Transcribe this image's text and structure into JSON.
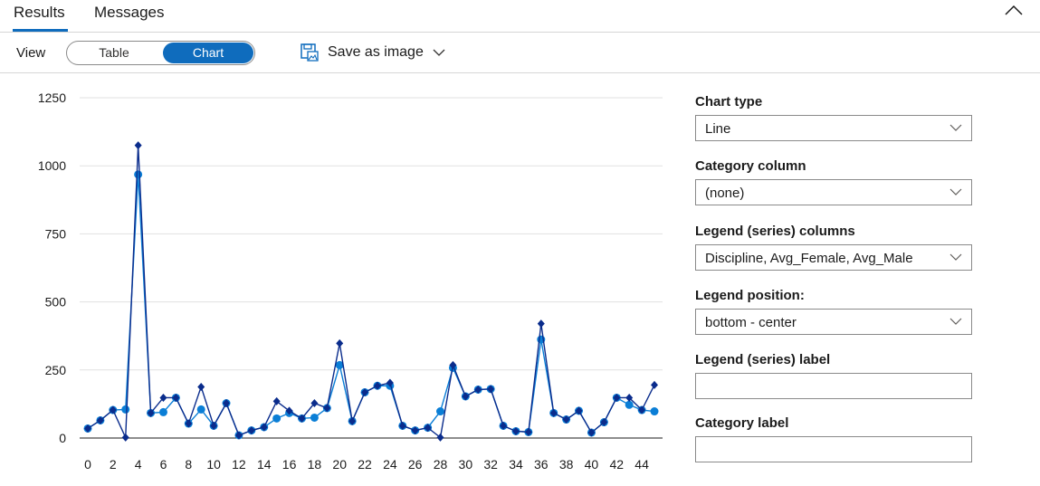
{
  "tabs": {
    "results": "Results",
    "messages": "Messages"
  },
  "toolbar": {
    "view_label": "View",
    "table_label": "Table",
    "chart_label": "Chart",
    "save_label": "Save as image"
  },
  "panel": {
    "chart_type_label": "Chart type",
    "chart_type_value": "Line",
    "category_column_label": "Category column",
    "category_column_value": "(none)",
    "legend_columns_label": "Legend (series) columns",
    "legend_columns_value": "Discipline, Avg_Female, Avg_Male",
    "legend_position_label": "Legend position:",
    "legend_position_value": "bottom - center",
    "legend_label_label": "Legend (series) label",
    "legend_label_value": "",
    "category_label_label": "Category label",
    "category_label_value": ""
  },
  "colors": {
    "accent": "#0f6cbd",
    "series_dark": "#0a2c8c",
    "series_light": "#0a7ed6"
  },
  "chart_data": {
    "type": "line",
    "x": [
      0,
      1,
      2,
      3,
      4,
      5,
      6,
      7,
      8,
      9,
      10,
      11,
      12,
      13,
      14,
      15,
      16,
      17,
      18,
      19,
      20,
      21,
      22,
      23,
      24,
      25,
      26,
      27,
      28,
      29,
      30,
      31,
      32,
      33,
      34,
      35,
      36,
      37,
      38,
      39,
      40,
      41,
      42,
      43,
      44,
      45
    ],
    "x_ticks": [
      0,
      2,
      4,
      6,
      8,
      10,
      12,
      14,
      16,
      18,
      20,
      22,
      24,
      26,
      28,
      30,
      32,
      34,
      36,
      38,
      40,
      42,
      44
    ],
    "y_ticks": [
      0,
      250,
      500,
      750,
      1000,
      1250
    ],
    "ylim": [
      0,
      1250
    ],
    "grid": true,
    "series": [
      {
        "marker": "diamond",
        "values": [
          35,
          65,
          103,
          2,
          1075,
          92,
          148,
          148,
          53,
          188,
          45,
          128,
          10,
          28,
          40,
          135,
          100,
          72,
          128,
          110,
          348,
          62,
          168,
          192,
          203,
          45,
          28,
          38,
          2,
          268,
          153,
          178,
          180,
          45,
          25,
          22,
          420,
          92,
          68,
          100,
          20,
          58,
          148,
          148,
          103,
          195
        ]
      },
      {
        "marker": "circle",
        "values": [
          35,
          65,
          103,
          105,
          968,
          92,
          95,
          148,
          53,
          105,
          45,
          128,
          10,
          28,
          40,
          72,
          92,
          72,
          75,
          110,
          268,
          62,
          168,
          192,
          192,
          45,
          28,
          38,
          98,
          258,
          153,
          178,
          180,
          45,
          25,
          22,
          362,
          92,
          68,
          100,
          20,
          58,
          148,
          122,
          103,
          98
        ]
      }
    ]
  }
}
